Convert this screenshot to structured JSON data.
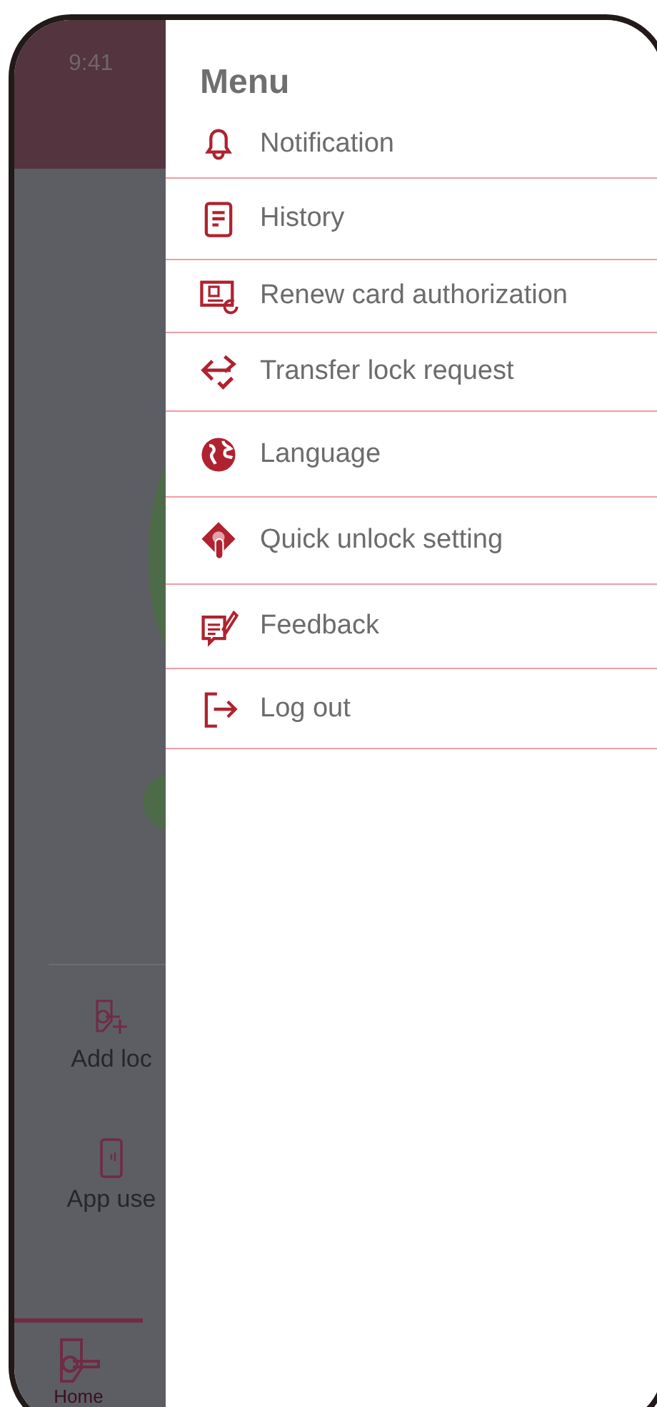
{
  "status_bar": {
    "time": "9:41"
  },
  "background": {
    "actions": [
      {
        "kind": "add-lock",
        "label": "Add loc"
      },
      {
        "kind": "phone",
        "label": "App use"
      }
    ],
    "tabs": [
      {
        "label": "Home",
        "selected": true
      }
    ]
  },
  "menu": {
    "title": "Menu",
    "items": [
      {
        "kind": "bell",
        "label": "Notification"
      },
      {
        "kind": "document",
        "label": "History"
      },
      {
        "kind": "card",
        "label": "Renew card authorization"
      },
      {
        "kind": "transfer",
        "label": "Transfer lock request"
      },
      {
        "kind": "globe",
        "label": "Language"
      },
      {
        "kind": "touch",
        "label": "Quick unlock setting"
      },
      {
        "kind": "feedback",
        "label": "Feedback"
      },
      {
        "kind": "logout",
        "label": "Log out"
      }
    ]
  }
}
